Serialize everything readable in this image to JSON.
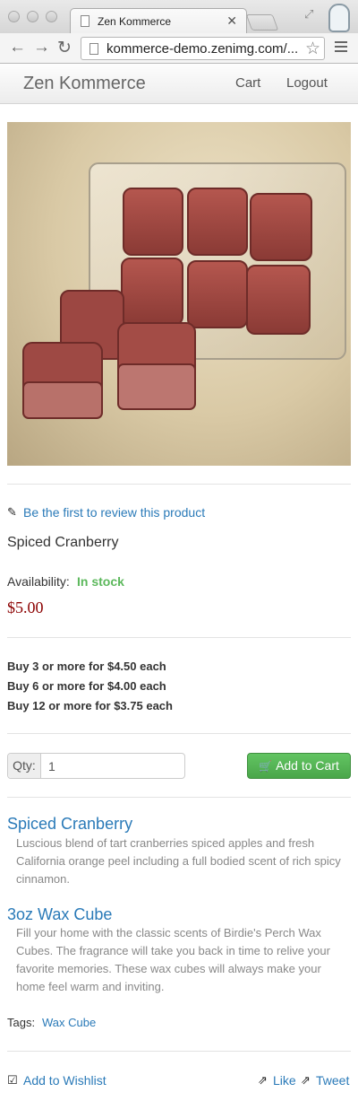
{
  "browser": {
    "tab_title": "Zen Kommerce",
    "url": "kommerce-demo.zenimg.com/..."
  },
  "nav": {
    "brand": "Zen Kommerce",
    "cart": "Cart",
    "logout": "Logout"
  },
  "product": {
    "review_link": "Be the first to review this product",
    "name": "Spiced Cranberry",
    "availability_label": "Availability:",
    "availability_value": "In stock",
    "price": "$5.00",
    "tiers": [
      "Buy 3 or more for $4.50 each",
      "Buy 6 or more for $4.00 each",
      "Buy 12 or more for $3.75 each"
    ],
    "qty_label": "Qty:",
    "qty_value": "1",
    "add_to_cart": "Add to Cart"
  },
  "details": [
    {
      "title": "Spiced Cranberry",
      "description": "Luscious blend of tart cranberries spiced apples and fresh California orange peel including a full bodied scent of rich spicy cinnamon."
    },
    {
      "title": "3oz Wax Cube",
      "description": "Fill your home with the classic scents of Birdie's Perch Wax Cubes. The fragrance will take you back in time to relive your favorite memories. These wax cubes will always make your home feel warm and inviting."
    }
  ],
  "tags": {
    "label": "Tags:",
    "items": [
      "Wax Cube"
    ]
  },
  "footer": {
    "wishlist": "Add to Wishlist",
    "like": "Like",
    "tweet": "Tweet"
  },
  "colors": {
    "link": "#2a7ab8",
    "in_stock": "#5cb85c",
    "price": "#8b0000",
    "add_to_cart_bg": "#5cb85c"
  }
}
